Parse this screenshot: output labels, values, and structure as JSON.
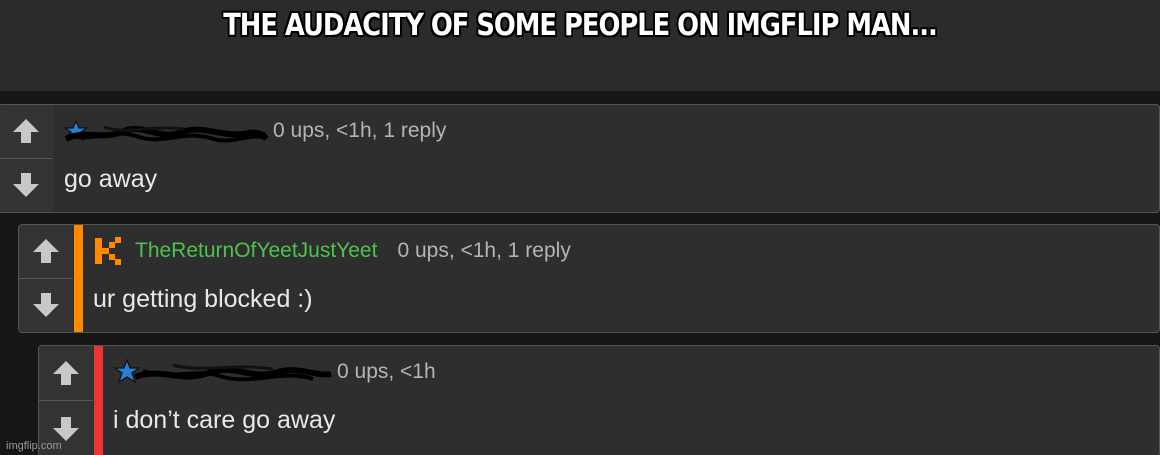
{
  "meme": {
    "caption": "THE AUDACITY OF SOME PEOPLE ON IMGFLIP MAN..."
  },
  "watermark": "imgflip.com",
  "comments": [
    {
      "username": "",
      "username_redacted": true,
      "user_icon": "star-icon",
      "meta": "0 ups, <1h, 1 reply",
      "text": "go away",
      "accent_color": null
    },
    {
      "username": "TheReturnOfYeetJustYeet",
      "username_redacted": false,
      "user_icon": "k-logo-icon",
      "username_color": "#4ec24e",
      "meta": "0 ups, <1h, 1 reply",
      "text": "ur getting blocked :)",
      "accent_color": "#ff8a00"
    },
    {
      "username": "",
      "username_redacted": true,
      "user_icon": "star-icon",
      "meta": "0 ups, <1h",
      "text": "i don’t care go away",
      "accent_color": "#ee3333"
    }
  ],
  "colors": {
    "background": "#161616",
    "comment_bg": "#2e2e2e",
    "border": "#555555",
    "vote_arrow": "#c8c8c8"
  }
}
